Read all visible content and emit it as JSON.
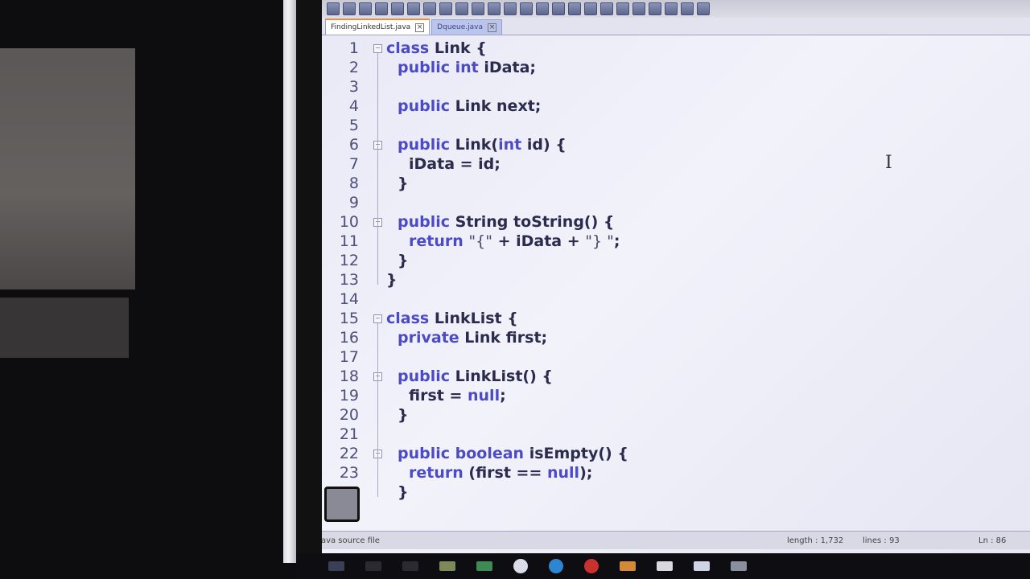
{
  "window": {
    "tabs": [
      {
        "label": "FindingLinkedList.java",
        "active": true
      },
      {
        "label": "Dqueue.java",
        "active": false
      }
    ]
  },
  "editor": {
    "language_status": "Java source file",
    "length_label": "length : 1,732",
    "lines_label": "lines : 93",
    "position_label": "Ln : 86",
    "lines": [
      {
        "n": "1",
        "html": "<span class='kw'>class</span> Link {",
        "indent": 0
      },
      {
        "n": "2",
        "html": "<span class='kw'>public int</span> iData;",
        "indent": 1
      },
      {
        "n": "3",
        "html": "",
        "indent": 0
      },
      {
        "n": "4",
        "html": "<span class='kw'>public</span> Link next;",
        "indent": 1
      },
      {
        "n": "5",
        "html": "",
        "indent": 0
      },
      {
        "n": "6",
        "html": "<span class='kw'>public</span> Link(<span class='kw'>int</span> id) {",
        "indent": 1
      },
      {
        "n": "7",
        "html": "iData = id;",
        "indent": 2
      },
      {
        "n": "8",
        "html": "}",
        "indent": 1
      },
      {
        "n": "9",
        "html": "",
        "indent": 0
      },
      {
        "n": "10",
        "html": "<span class='kw'>public</span> String toString() {",
        "indent": 1
      },
      {
        "n": "11",
        "html": "<span class='kw'>return</span> <span class='str'>\"{\"</span> + iData + <span class='str'>\"} \"</span>;",
        "indent": 2
      },
      {
        "n": "12",
        "html": "}",
        "indent": 1
      },
      {
        "n": "13",
        "html": "}",
        "indent": 0
      },
      {
        "n": "14",
        "html": "",
        "indent": 0
      },
      {
        "n": "15",
        "html": "<span class='kw'>class</span> LinkList {",
        "indent": 0
      },
      {
        "n": "16",
        "html": "<span class='kw'>private</span> Link first;",
        "indent": 1
      },
      {
        "n": "17",
        "html": "",
        "indent": 0
      },
      {
        "n": "18",
        "html": "<span class='kw'>public</span> LinkList() {",
        "indent": 1
      },
      {
        "n": "19",
        "html": "first = <span class='kw'>null</span>;",
        "indent": 2
      },
      {
        "n": "20",
        "html": "}",
        "indent": 1
      },
      {
        "n": "21",
        "html": "",
        "indent": 0
      },
      {
        "n": "22",
        "html": "<span class='kw'>public boolean</span> isEmpty() {",
        "indent": 1
      },
      {
        "n": "23",
        "html": "<span class='kw'>return</span> (first == <span class='kw'>null</span>);",
        "indent": 2
      },
      {
        "n": "",
        "html": "}",
        "indent": 1
      }
    ],
    "fold_markers": [
      1,
      6,
      10,
      15,
      18,
      22
    ]
  },
  "colors": {
    "keyword": "#4d4bc4",
    "text": "#2a2b4d",
    "line_number": "#4c4f78",
    "active_tab_accent": "#f08a3c"
  }
}
